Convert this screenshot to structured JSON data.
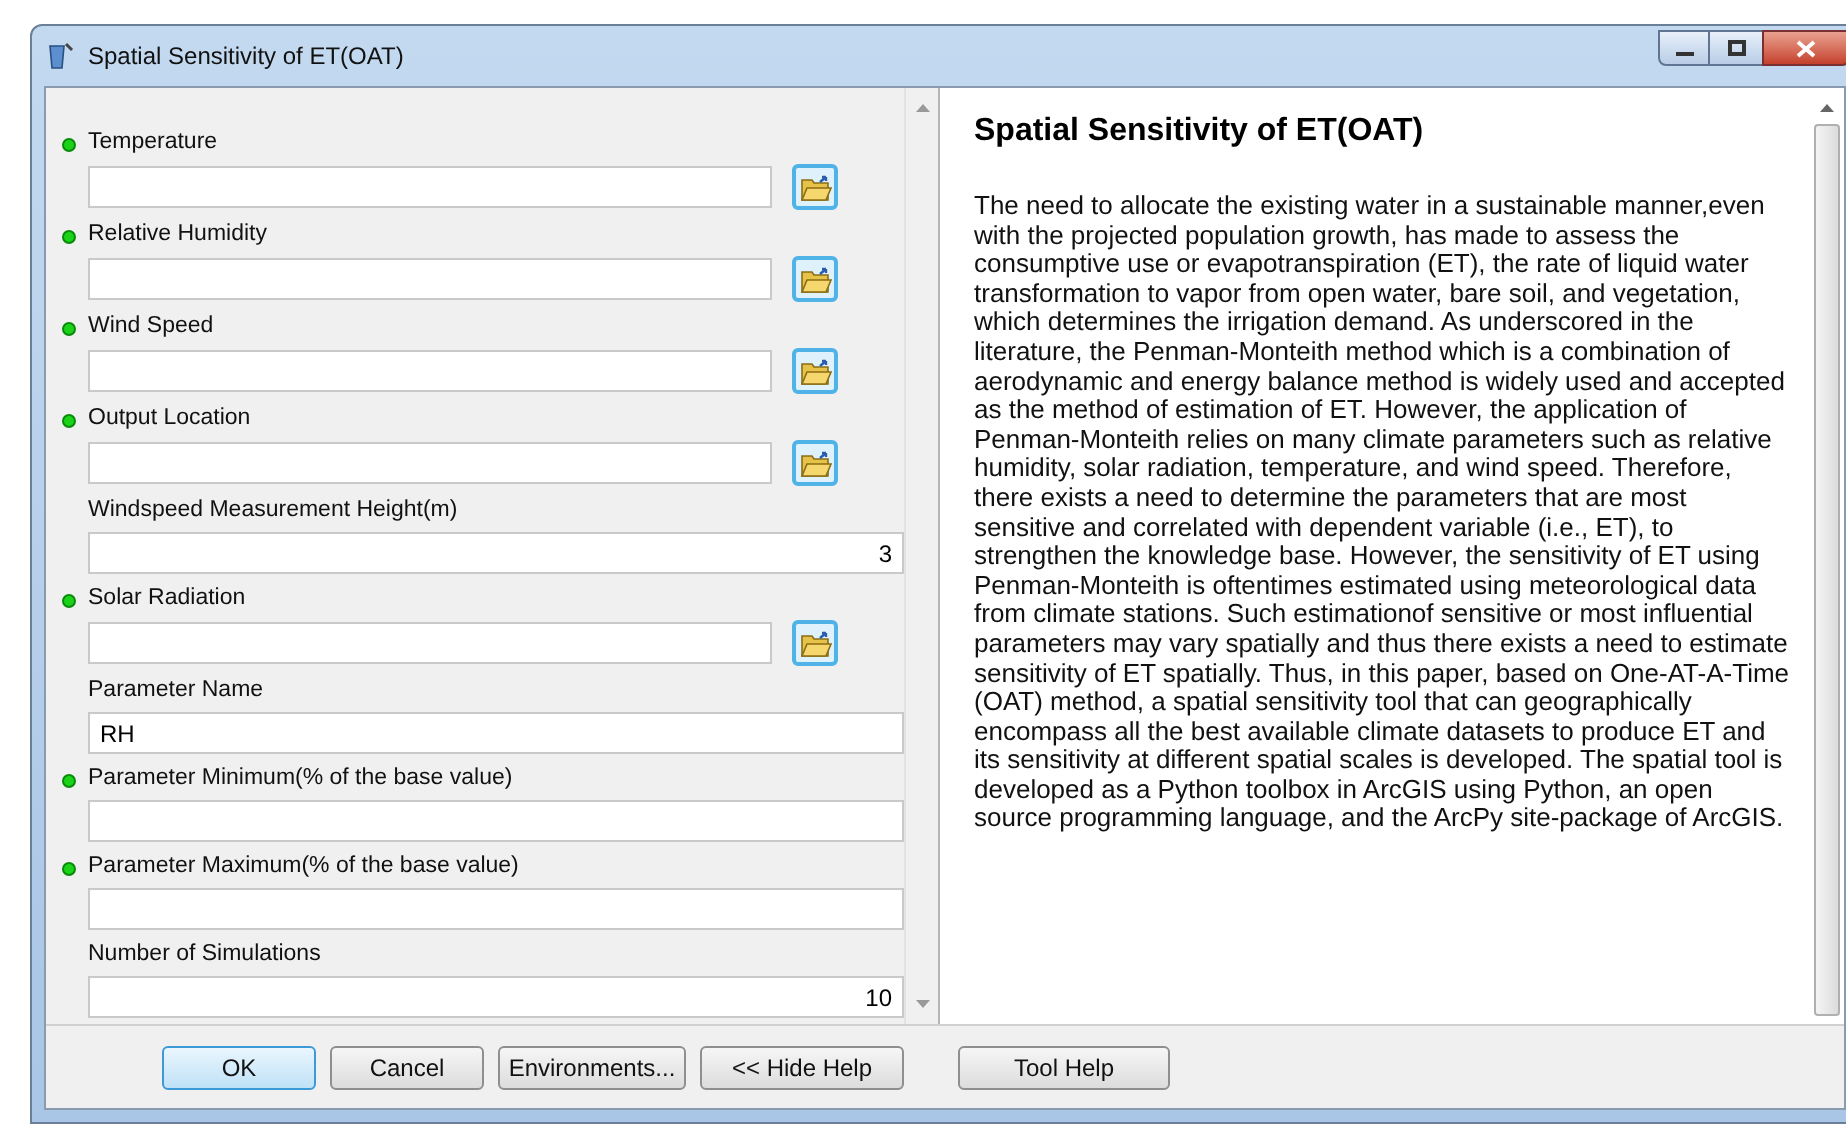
{
  "window": {
    "title": "Spatial Sensitivity of ET(OAT)"
  },
  "fields": [
    {
      "label": "Temperature",
      "required": true,
      "kind": "path"
    },
    {
      "label": "Relative Humidity",
      "required": true,
      "kind": "path"
    },
    {
      "label": "Wind Speed",
      "required": true,
      "kind": "path"
    },
    {
      "label": "Output Location",
      "required": true,
      "kind": "path"
    },
    {
      "label": "Windspeed Measurement Height(m)",
      "required": false,
      "kind": "number",
      "value": "3"
    },
    {
      "label": "Solar Radiation",
      "required": true,
      "kind": "path"
    },
    {
      "label": "Parameter Name",
      "required": false,
      "kind": "text",
      "value": "RH"
    },
    {
      "label": "Parameter Minimum(% of the base value)",
      "required": true,
      "kind": "number"
    },
    {
      "label": "Parameter Maximum(% of the base value)",
      "required": true,
      "kind": "number"
    },
    {
      "label": "Number of Simulations",
      "required": false,
      "kind": "number",
      "value": "10"
    }
  ],
  "help": {
    "title": "Spatial Sensitivity of ET(OAT)",
    "body": "The need to allocate the existing water in a sustainable manner,even with the projected population growth, has made to assess the consumptive use or evapotranspiration (ET), the rate of liquid water transformation to vapor from open water, bare soil, and vegetation, which determines the irrigation demand. As underscored in the literature, the Penman-Monteith method which is a combination of aerodynamic and energy balance method is widely used and accepted as the method of estimation of ET. However, the application of Penman-Monteith relies on many climate parameters such as relative humidity, solar radiation, temperature, and wind speed. Therefore, there exists a need to determine the parameters that are most sensitive and correlated with dependent variable (i.e., ET), to strengthen the knowledge base. However, the sensitivity of ET using Penman-Monteith is oftentimes estimated using meteorological data from climate stations. Such estimationof sensitive or most influential parameters may vary spatially and thus there exists a need to estimate sensitivity of ET spatially. Thus, in this paper, based on One-AT-A-Time (OAT) method, a spatial sensitivity tool that can geographically encompass all the best available climate datasets to produce ET and its sensitivity at different spatial scales is developed. The spatial tool is developed as a Python toolbox in ArcGIS using Python, an open source programming language, and the ArcPy site-package of ArcGIS."
  },
  "buttons": [
    {
      "label": "OK",
      "default": true
    },
    {
      "label": "Cancel",
      "default": false
    },
    {
      "label": "Environments...",
      "default": false
    },
    {
      "label": "<< Hide Help",
      "default": false
    },
    {
      "label": "Tool Help",
      "default": false
    }
  ]
}
